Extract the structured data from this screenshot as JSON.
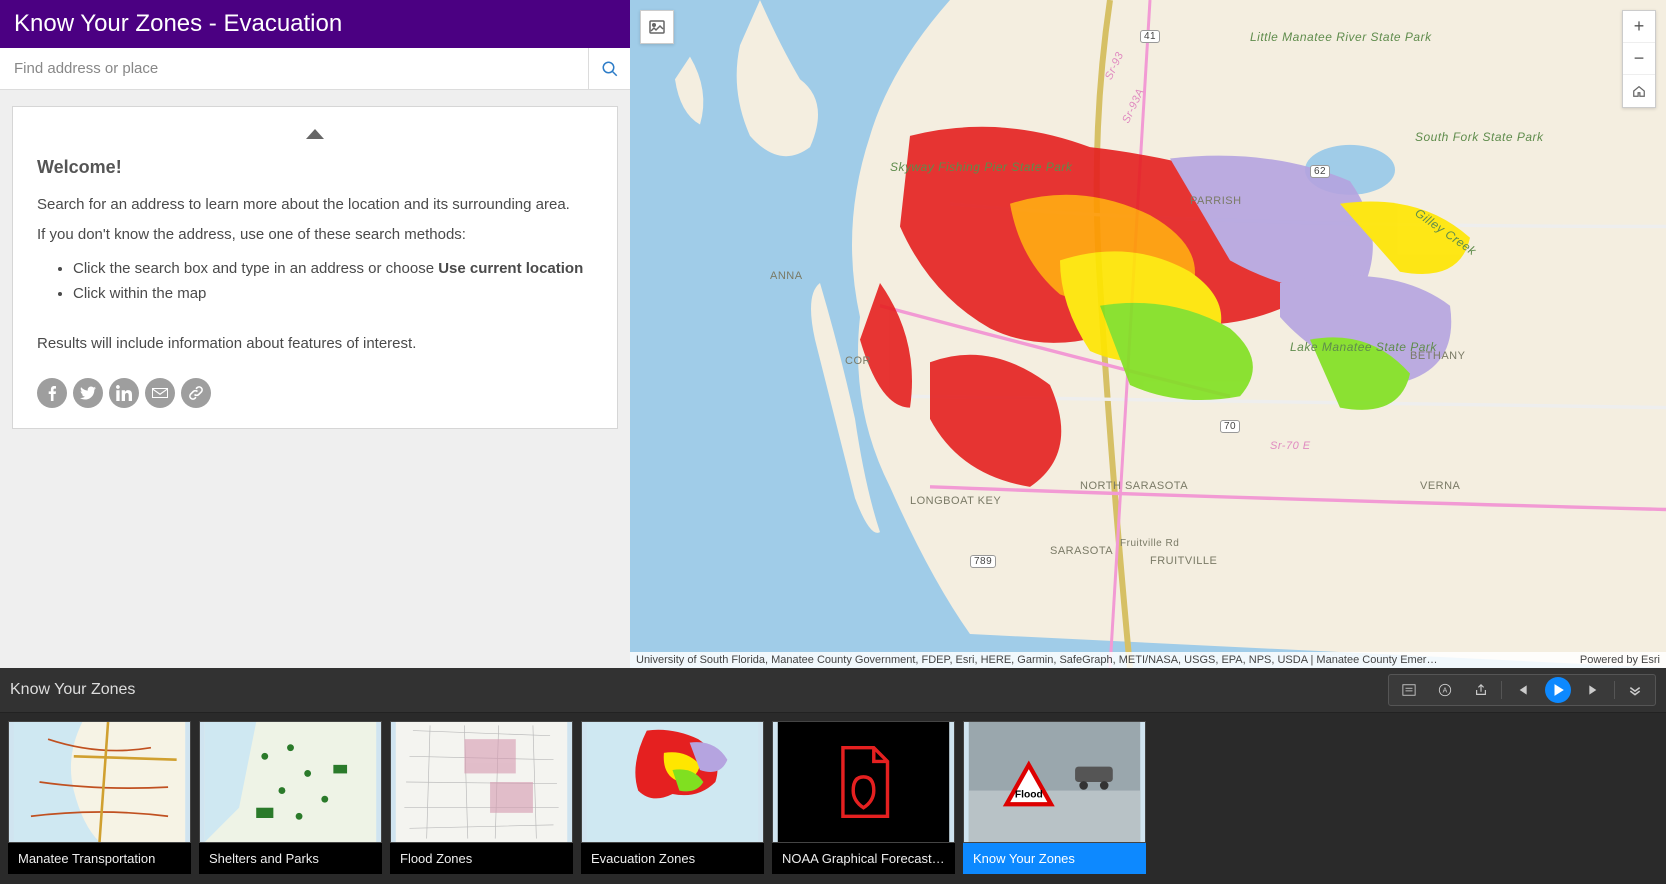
{
  "header": {
    "title": "Know Your Zones - Evacuation"
  },
  "search": {
    "placeholder": "Find address or place"
  },
  "welcome": {
    "heading": "Welcome!",
    "line1": "Search for an address to learn more about the location and its surrounding area.",
    "line2": "If you don't know the address, use one of these search methods:",
    "bullet1_prefix": "Click the search box and type in an address or choose ",
    "bullet1_strong": "Use current location",
    "bullet2": "Click within the map",
    "results": "Results will include information about features of interest."
  },
  "share": {
    "facebook": "facebook",
    "twitter": "twitter",
    "linkedin": "linkedin",
    "email": "email",
    "link": "link"
  },
  "map": {
    "attribution": "University of South Florida, Manatee County Government, FDEP, Esri, HERE, Garmin, SafeGraph, METI/NASA, USGS, EPA, NPS, USDA | Manatee County Emer…",
    "powered": "Powered by Esri",
    "labels": {
      "skyway": "Skyway Fishing Pier State Park",
      "little_manatee": "Little Manatee River State Park",
      "south_fork": "South Fork State Park",
      "lake_manatee": "Lake Manatee State Park",
      "parrish": "PARRISH",
      "anna": "ANNA",
      "cor": "COR",
      "north_sarasota": "NORTH SARASOTA",
      "longboat": "LONGBOAT KEY",
      "sarasota": "SARASOTA",
      "fruitville": "FRUITVILLE",
      "fruitville_rd": "Fruitville Rd",
      "bethany": "BETHANY",
      "verna": "VERNA",
      "gilley": "Gilley Creek",
      "sr70e": "Sr-70 E",
      "sr93": "Sr-93",
      "sr93a": "Sr-93A"
    },
    "routes": {
      "r62": "62",
      "r70": "70",
      "r41": "41",
      "r789": "789"
    }
  },
  "gallery": {
    "title": "Know Your Zones",
    "items": [
      {
        "label": "Manatee Transportation",
        "kind": "map-roads"
      },
      {
        "label": "Shelters and Parks",
        "kind": "map-dots"
      },
      {
        "label": "Flood Zones",
        "kind": "map-gray"
      },
      {
        "label": "Evacuation Zones",
        "kind": "map-evac"
      },
      {
        "label": "NOAA Graphical Forecasts -",
        "kind": "pdf"
      },
      {
        "label": "Know Your Zones",
        "kind": "flood-photo",
        "active": true
      }
    ]
  }
}
